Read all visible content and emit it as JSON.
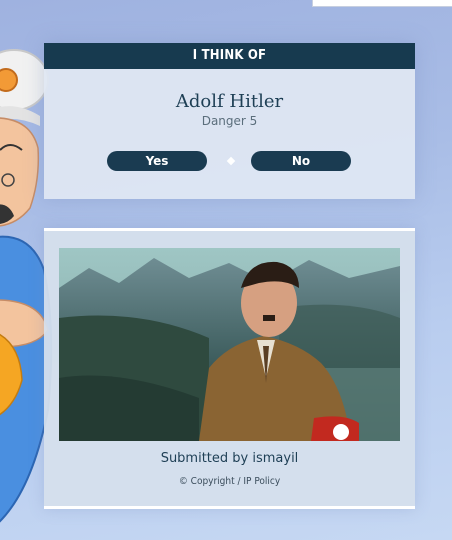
{
  "question_card": {
    "header": "I THINK OF",
    "answer_name": "Adolf Hitler",
    "answer_detail": "Danger 5",
    "yes_label": "Yes",
    "no_label": "No"
  },
  "result_card": {
    "submitted_text": "Submitted by ismayil",
    "copyright_label": "© Copyright",
    "separator": " / ",
    "ip_policy_label": "IP Policy"
  },
  "colors": {
    "header_bg": "#173a4f",
    "button_bg": "#1a3b51",
    "text_dark": "#1e3f55"
  }
}
